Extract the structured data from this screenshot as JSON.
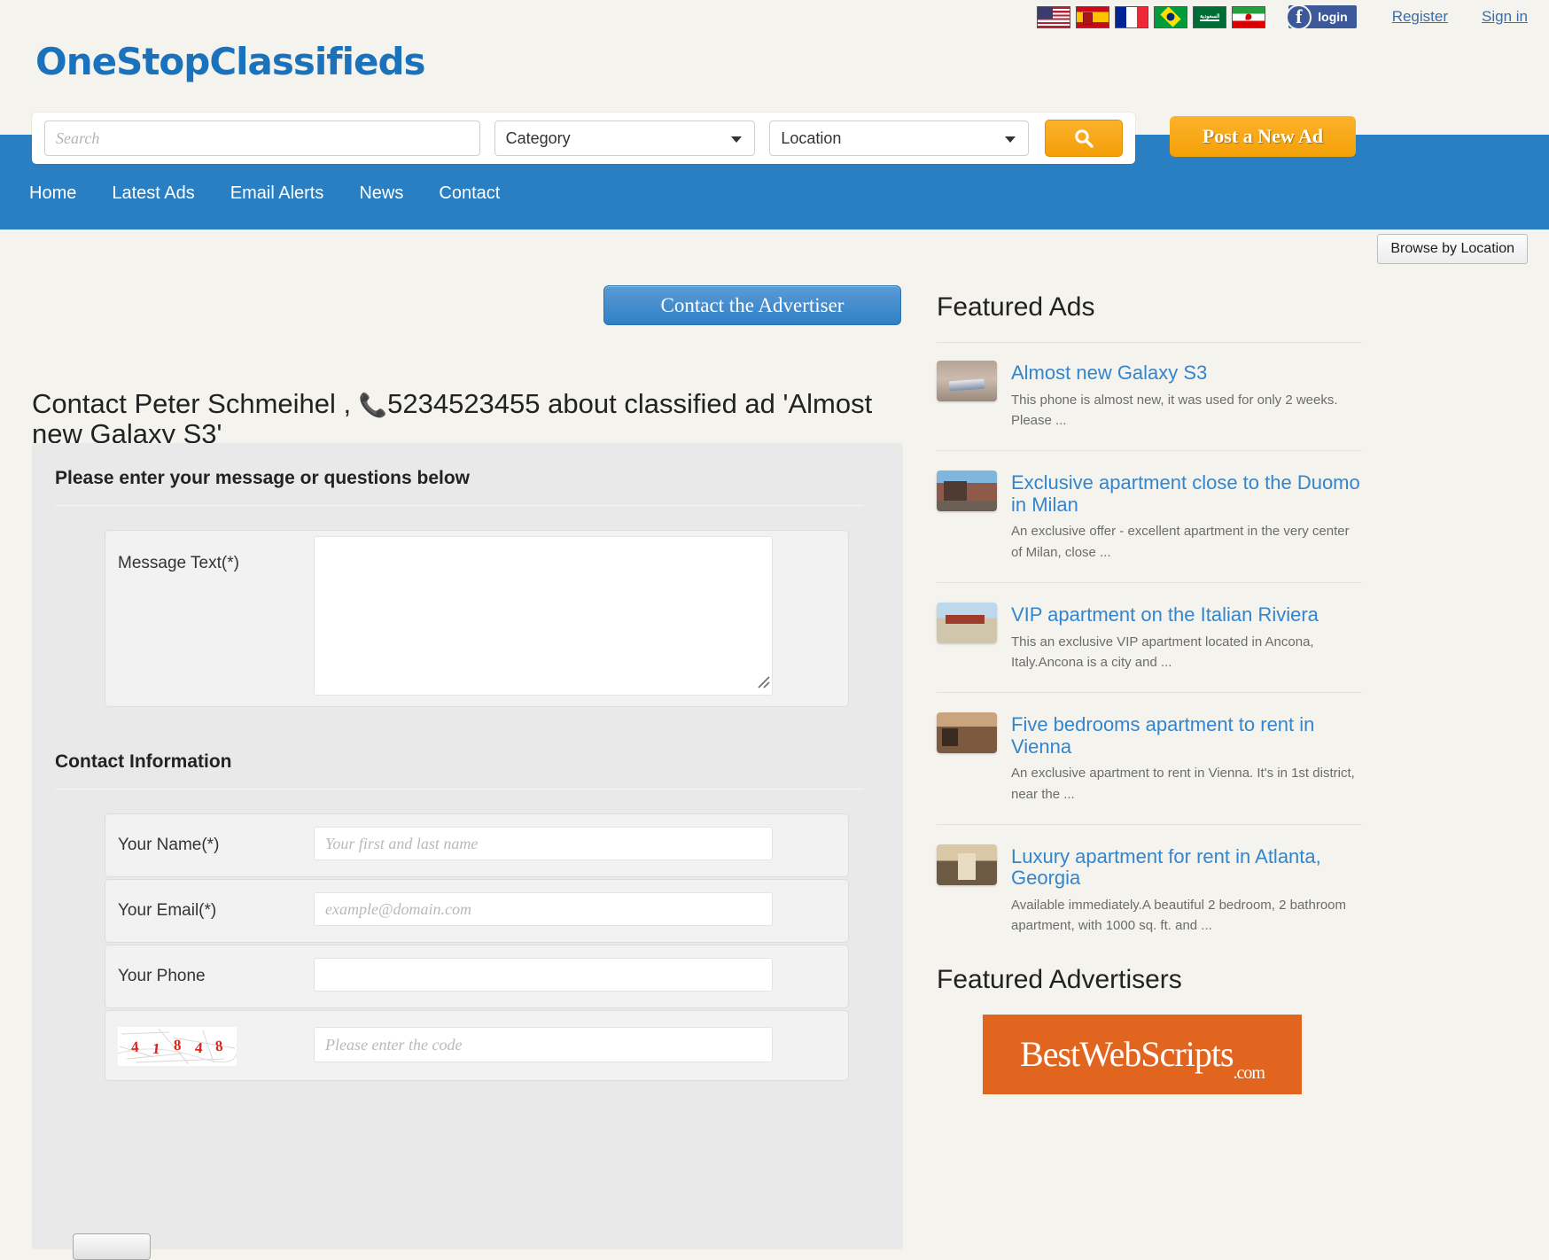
{
  "topbar": {
    "flags": [
      {
        "name": "flag-us",
        "label": "United States"
      },
      {
        "name": "flag-es",
        "label": "Spain"
      },
      {
        "name": "flag-fr",
        "label": "France"
      },
      {
        "name": "flag-br",
        "label": "Brazil"
      },
      {
        "name": "flag-sa",
        "label": "Saudi Arabia",
        "text": "السعودية"
      },
      {
        "name": "flag-ir",
        "label": "Iran"
      }
    ],
    "facebook_label": "login",
    "facebook_glyph": "f",
    "register": "Register",
    "signin": "Sign in"
  },
  "logo": "OneStopClassifieds",
  "search": {
    "input_placeholder": "Search",
    "input_value": "",
    "category_label": "Category",
    "location_label": "Location",
    "search_icon": "search-icon",
    "post_ad_label": "Post a New Ad"
  },
  "nav": {
    "items": [
      {
        "label": "Home"
      },
      {
        "label": "Latest Ads"
      },
      {
        "label": "Email Alerts"
      },
      {
        "label": "News"
      },
      {
        "label": "Contact"
      }
    ]
  },
  "browse_by_location": "Browse by Location",
  "main": {
    "contact_advertiser_button": "Contact the Advertiser",
    "page_title_prefix": "Contact Peter Schmeihel , ",
    "phone_icon": "📞",
    "page_title_suffix": "5234523455 about classified ad 'Almost new Galaxy S3'",
    "form_heading": "Please enter your message or questions below",
    "message_label": "Message Text(*)",
    "message_value": "",
    "contact_info_heading": "Contact Information",
    "fields": [
      {
        "label": "Your Name(*)",
        "placeholder": "Your first and last name",
        "value": ""
      },
      {
        "label": "Your Email(*)",
        "placeholder": "example@domain.com",
        "value": ""
      },
      {
        "label": "Your Phone",
        "placeholder": "",
        "value": ""
      }
    ],
    "captcha": {
      "digits": [
        "4",
        "1",
        "8",
        "4",
        "8"
      ],
      "placeholder": "Please enter the code",
      "value": "",
      "color": "#e2231a"
    }
  },
  "sidebar": {
    "featured_ads_heading": "Featured Ads",
    "ads": [
      {
        "title": "Almost new Galaxy S3",
        "desc": "This phone is almost new, it was used for only 2 weeks. Please ...",
        "thumb": "galaxy-s3-thumb"
      },
      {
        "title": "Exclusive apartment close to the Duomo in Milan",
        "desc": "An exclusive offer - excellent apartment in the very center of Milan, close ...",
        "thumb": "milan-apartment-thumb"
      },
      {
        "title": "VIP apartment on the Italian Riviera",
        "desc": "This an exclusive VIP apartment located in Ancona, Italy.Ancona is a city and ...",
        "thumb": "riviera-apartment-thumb"
      },
      {
        "title": "Five bedrooms apartment to rent in Vienna",
        "desc": "An exclusive apartment to rent in Vienna. It's in 1st district, near the ...",
        "thumb": "vienna-apartment-thumb"
      },
      {
        "title": "Luxury apartment for rent in Atlanta, Georgia",
        "desc": "Available immediately.A beautiful 2 bedroom, 2 bathroom apartment, with 1000 sq. ft. and ...",
        "thumb": "atlanta-apartment-thumb"
      }
    ],
    "featured_advertisers_heading": "Featured Advertisers",
    "advertiser_banner": {
      "name": "BestWebScripts",
      "suffix": ".com",
      "color": "#e2651f"
    }
  },
  "colors": {
    "brand_blue": "#1a72bc",
    "nav_blue": "#2a7fc2",
    "accent_orange": "#f5a006",
    "link_blue": "#3385cc",
    "page_bg": "#f4f3ee"
  }
}
